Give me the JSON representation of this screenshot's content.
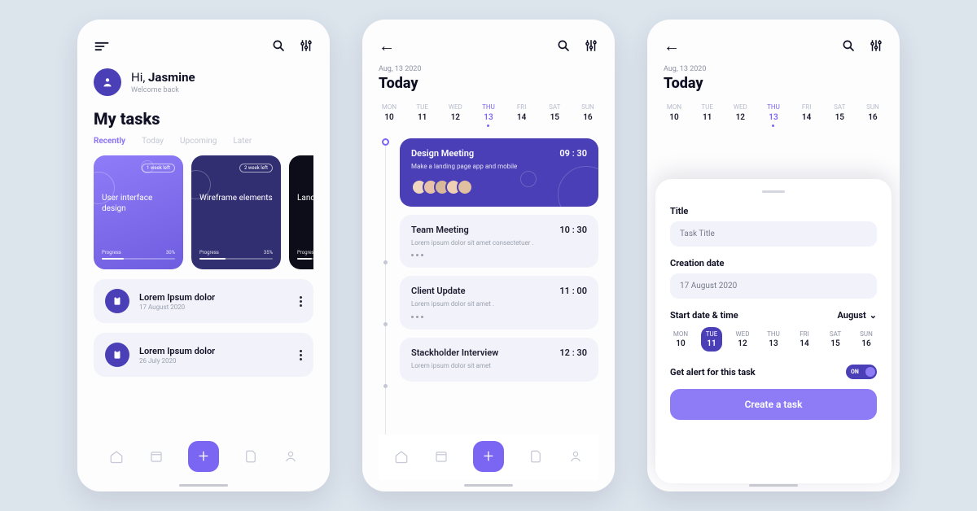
{
  "s1": {
    "greeting_prefix": "Hi, ",
    "greeting_name": "Jasmine",
    "welcome": "Welcome back",
    "title": "My tasks",
    "tabs": [
      "Recently",
      "Today",
      "Upcoming",
      "Later"
    ],
    "cards": [
      {
        "badge": "1 week left",
        "title": "User interface design",
        "progress_label": "Progress",
        "pct": "30%",
        "pct_w": 30
      },
      {
        "badge": "2 week left",
        "title": "Wireframe elements",
        "progress_label": "Progress",
        "pct": "35%",
        "pct_w": 35
      },
      {
        "badge": "",
        "title": "Landing design",
        "progress_label": "Progress",
        "pct": "",
        "pct_w": 20
      }
    ],
    "list": [
      {
        "title": "Lorem Ipsum dolor",
        "date": "17 August 2020"
      },
      {
        "title": "Lorem Ipsum dolor",
        "date": "26 July 2020"
      }
    ]
  },
  "s2": {
    "datelabel": "Aug, 13 2020",
    "today": "Today",
    "week": [
      {
        "wd": "MON",
        "d": "10"
      },
      {
        "wd": "TUE",
        "d": "11"
      },
      {
        "wd": "WED",
        "d": "12"
      },
      {
        "wd": "THU",
        "d": "13",
        "active": true
      },
      {
        "wd": "FRI",
        "d": "14"
      },
      {
        "wd": "SAT",
        "d": "15"
      },
      {
        "wd": "SUN",
        "d": "16"
      }
    ],
    "events": [
      {
        "title": "Design Meeting",
        "time": "09 : 30",
        "desc": "Make a landing page app and mobile",
        "hl": true
      },
      {
        "title": "Team Meeting",
        "time": "10 : 30",
        "desc": "Lorem ipsum dolor sit amet consectetuer ."
      },
      {
        "title": "Client Update",
        "time": "11 : 00",
        "desc": "Lorem ipsum dolor sit amet ."
      },
      {
        "title": "Stackholder Interview",
        "time": "12 : 30",
        "desc": "Lorem ipsum dolor sit amet"
      }
    ]
  },
  "s3": {
    "datelabel": "Aug, 13 2020",
    "today": "Today",
    "week": [
      {
        "wd": "MON",
        "d": "10"
      },
      {
        "wd": "TUE",
        "d": "11"
      },
      {
        "wd": "WED",
        "d": "12"
      },
      {
        "wd": "THU",
        "d": "13",
        "active": true
      },
      {
        "wd": "FRI",
        "d": "14"
      },
      {
        "wd": "SAT",
        "d": "15"
      },
      {
        "wd": "SUN",
        "d": "16"
      }
    ],
    "form": {
      "title_label": "Title",
      "title_ph": "Task Title",
      "cdate_label": "Creation date",
      "cdate_val": "17 August 2020",
      "sd_label": "Start date & time",
      "month": "August",
      "week": [
        {
          "wd": "MON",
          "d": "10"
        },
        {
          "wd": "TUE",
          "d": "11",
          "sel": true
        },
        {
          "wd": "WED",
          "d": "12"
        },
        {
          "wd": "THU",
          "d": "13"
        },
        {
          "wd": "FRI",
          "d": "14"
        },
        {
          "wd": "SAT",
          "d": "15"
        },
        {
          "wd": "SUN",
          "d": "16"
        }
      ],
      "alert_label": "Get alert for this task",
      "toggle_label": "ON",
      "create": "Create a task"
    }
  }
}
